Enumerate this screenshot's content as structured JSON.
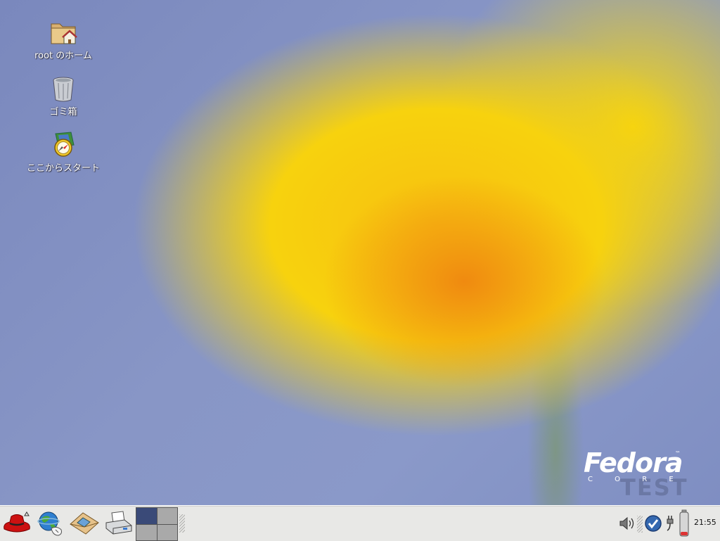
{
  "desktop": {
    "icons": [
      {
        "label": "root のホーム",
        "icon": "home-folder-icon"
      },
      {
        "label": "ゴミ箱",
        "icon": "trash-icon"
      },
      {
        "label": "ここからスタート",
        "icon": "start-here-icon"
      }
    ],
    "watermark": {
      "brand": "Fedora",
      "sub": "C O R E",
      "tag": "TEST",
      "tm": "™"
    }
  },
  "panel": {
    "launchers": [
      "redhat-menu-icon",
      "web-browser-icon",
      "email-icon",
      "printer-icon"
    ],
    "workspaces": {
      "count": 4,
      "active": 1
    },
    "tray": [
      "volume-icon",
      "update-check-icon",
      "power-plug-icon",
      "battery-icon"
    ],
    "clock": "21:55"
  },
  "colors": {
    "panel_bg": "#e8e8e6",
    "workspace_active": "#3a4a78",
    "workspace_inactive": "#a9a9a9"
  }
}
